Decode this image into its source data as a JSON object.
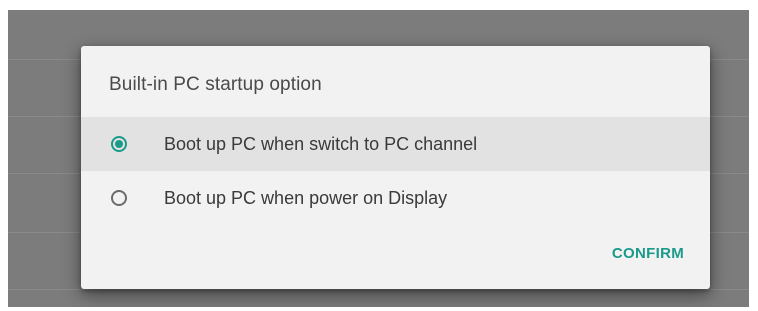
{
  "dialog": {
    "title": "Built-in PC startup option",
    "options": [
      {
        "label": "Boot up PC when switch to PC channel",
        "selected": true
      },
      {
        "label": "Boot up PC when power on Display",
        "selected": false
      }
    ],
    "confirm_label": "CONFIRM"
  },
  "colors": {
    "accent": "#1a9a8a",
    "dialog_background": "#f2f2f2",
    "selected_row": "#e2e2e2",
    "scrim": "#7c7c7c"
  }
}
